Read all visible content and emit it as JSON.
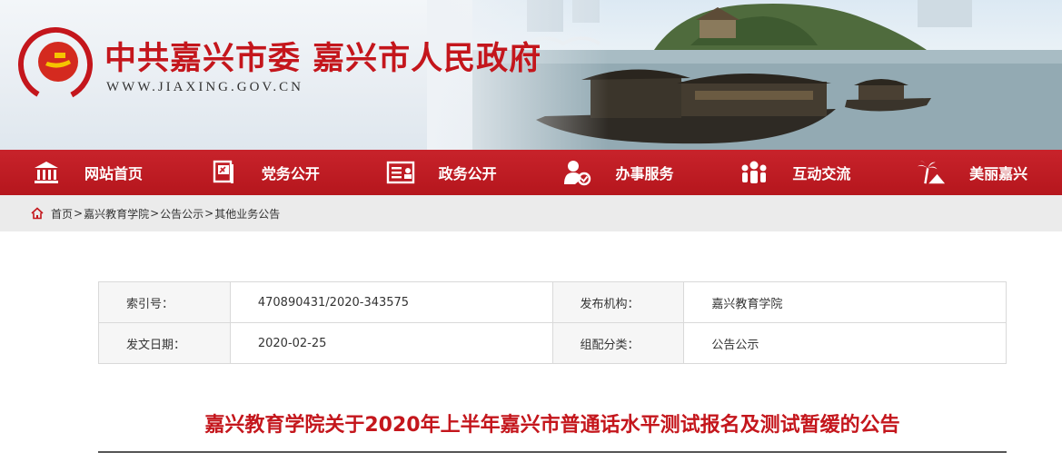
{
  "header": {
    "site_title": "中共嘉兴市委 嘉兴市人民政府",
    "site_url": "WWW.JIAXING.GOV.CN"
  },
  "nav": {
    "items": [
      {
        "label": "网站首页",
        "icon": "building-icon"
      },
      {
        "label": "党务公开",
        "icon": "party-flag-icon"
      },
      {
        "label": "政务公开",
        "icon": "document-icon"
      },
      {
        "label": "办事服务",
        "icon": "person-service-icon"
      },
      {
        "label": "互动交流",
        "icon": "people-group-icon"
      },
      {
        "label": "美丽嘉兴",
        "icon": "palm-tree-icon"
      }
    ]
  },
  "breadcrumb": {
    "items": [
      "首页",
      "嘉兴教育学院",
      "公告公示",
      "其他业务公告"
    ],
    "separator": ">"
  },
  "info": {
    "index_label": "索引号：",
    "index_value": "470890431/2020-343575",
    "publisher_label": "发布机构：",
    "publisher_value": "嘉兴教育学院",
    "date_label": "发文日期：",
    "date_value": "2020-02-25",
    "category_label": "组配分类：",
    "category_value": "公告公示"
  },
  "article": {
    "title": "嘉兴教育学院关于2020年上半年嘉兴市普通话水平测试报名及测试暂缓的公告"
  },
  "colors": {
    "brand_red": "#c4161c",
    "nav_red": "#b5161d",
    "breadcrumb_bg": "#ebebeb"
  }
}
